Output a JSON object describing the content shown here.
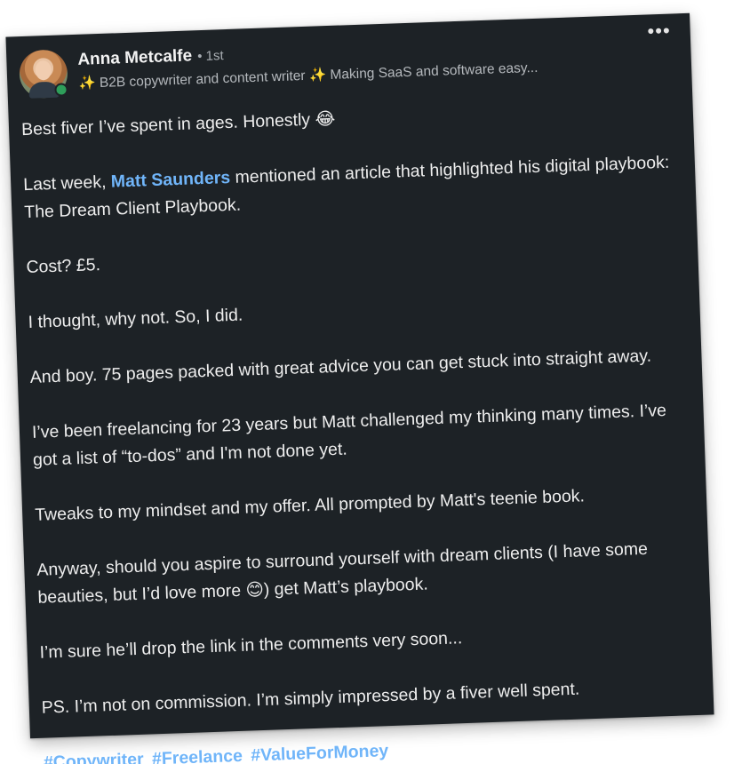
{
  "post": {
    "author": {
      "name": "Anna Metcalfe",
      "degree": "• 1st",
      "headline_prefix": "✨",
      "headline_main": " B2B copywriter and content writer ",
      "headline_sparkle": "✨",
      "headline_tail": " Making SaaS and software easy...",
      "online": true
    },
    "more_label": "•••",
    "paragraphs": {
      "p1": "Best fiver I’ve spent in ages. Honestly 😂",
      "p2_before": "Last week, ",
      "p2_mention": "Matt Saunders",
      "p2_after": " mentioned an article that highlighted his digital playbook: The Dream Client Playbook.",
      "p3": "Cost? £5.",
      "p4": "I thought, why not. So, I did.",
      "p5": "And boy. 75 pages packed with great advice you can get stuck into straight away.",
      "p6": "I’ve been freelancing for 23 years but Matt challenged my thinking many times. I’ve got a list of “to-dos” and I'm not done yet.",
      "p7": "Tweaks to my mindset and my offer. All prompted by Matt's teenie book.",
      "p8": "Anyway, should you aspire to surround yourself with dream clients (I have some beauties, but I’d love more 😊) get Matt’s playbook.",
      "p9": "I’m sure he’ll drop the link in the comments very soon...",
      "p10": "PS. I’m not on commission. I’m simply impressed by a fiver well spent."
    },
    "hashtags": [
      "#Copywriter",
      "#Freelance",
      "#ValueForMoney"
    ]
  },
  "colors": {
    "card_bg": "#1d2226",
    "link": "#70b5f9",
    "presence": "#2e9e5a"
  }
}
